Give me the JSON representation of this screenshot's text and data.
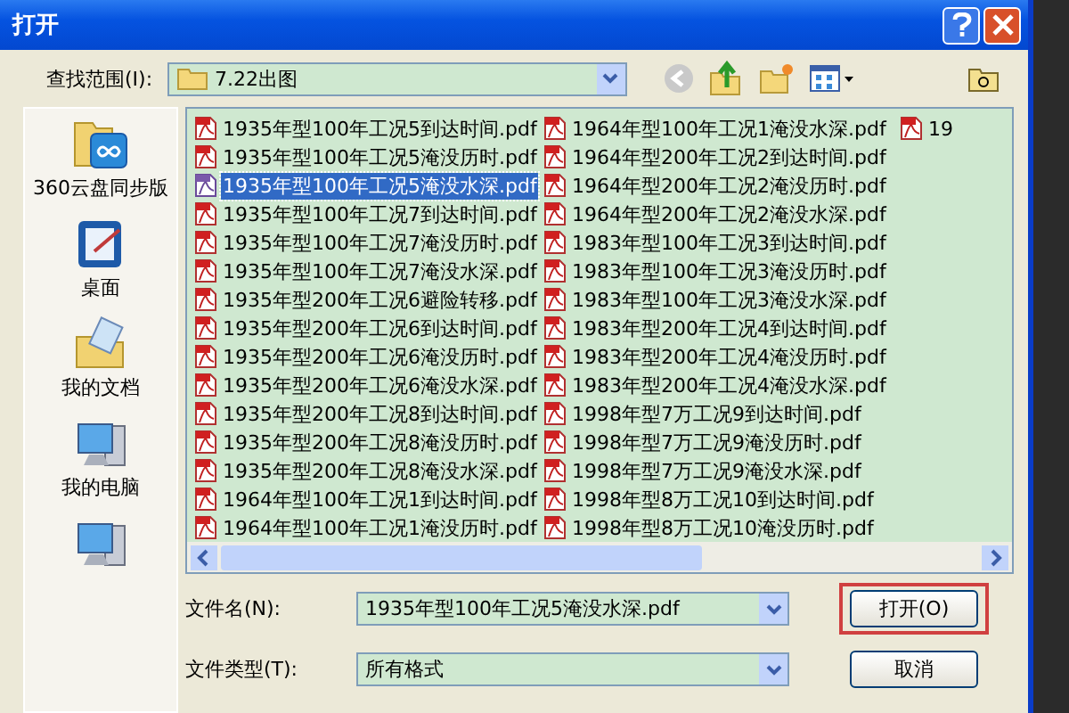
{
  "window": {
    "title": "打开"
  },
  "look_in": {
    "label": "查找范围(I):",
    "value": "7.22出图"
  },
  "sidebar": {
    "items": [
      {
        "label": "360云盘同步版",
        "kind": "cloud"
      },
      {
        "label": "桌面",
        "kind": "desktop"
      },
      {
        "label": "我的文档",
        "kind": "documents"
      },
      {
        "label": "我的电脑",
        "kind": "computer"
      },
      {
        "kind": "network"
      }
    ]
  },
  "files": [
    {
      "name": "1935年型100年工况5到达时间.pdf",
      "selected": false
    },
    {
      "name": "1935年型100年工况5淹没历时.pdf",
      "selected": false
    },
    {
      "name": "1935年型100年工况5淹没水深.pdf",
      "selected": true
    },
    {
      "name": "1935年型100年工况7到达时间.pdf",
      "selected": false
    },
    {
      "name": "1935年型100年工况7淹没历时.pdf",
      "selected": false
    },
    {
      "name": "1935年型100年工况7淹没水深.pdf",
      "selected": false
    },
    {
      "name": "1935年型200年工况6避险转移.pdf",
      "selected": false
    },
    {
      "name": "1935年型200年工况6到达时间.pdf",
      "selected": false
    },
    {
      "name": "1935年型200年工况6淹没历时.pdf",
      "selected": false
    },
    {
      "name": "1935年型200年工况6淹没水深.pdf",
      "selected": false
    },
    {
      "name": "1935年型200年工况8到达时间.pdf",
      "selected": false
    },
    {
      "name": "1935年型200年工况8淹没历时.pdf",
      "selected": false
    },
    {
      "name": "1935年型200年工况8淹没水深.pdf",
      "selected": false
    },
    {
      "name": "1964年型100年工况1到达时间.pdf",
      "selected": false
    },
    {
      "name": "1964年型100年工况1淹没历时.pdf",
      "selected": false
    },
    {
      "name": "1964年型100年工况1淹没水深.pdf",
      "selected": false
    },
    {
      "name": "1964年型200年工况2到达时间.pdf",
      "selected": false
    },
    {
      "name": "1964年型200年工况2淹没历时.pdf",
      "selected": false
    },
    {
      "name": "1964年型200年工况2淹没水深.pdf",
      "selected": false
    },
    {
      "name": "1983年型100年工况3到达时间.pdf",
      "selected": false
    },
    {
      "name": "1983年型100年工况3淹没历时.pdf",
      "selected": false
    },
    {
      "name": "1983年型100年工况3淹没水深.pdf",
      "selected": false
    },
    {
      "name": "1983年型200年工况4到达时间.pdf",
      "selected": false
    },
    {
      "name": "1983年型200年工况4淹没历时.pdf",
      "selected": false
    },
    {
      "name": "1983年型200年工况4淹没水深.pdf",
      "selected": false
    },
    {
      "name": "1998年型7万工况9到达时间.pdf",
      "selected": false
    },
    {
      "name": "1998年型7万工况9淹没历时.pdf",
      "selected": false
    },
    {
      "name": "1998年型7万工况9淹没水深.pdf",
      "selected": false
    },
    {
      "name": "1998年型8万工况10到达时间.pdf",
      "selected": false
    },
    {
      "name": "1998年型8万工况10淹没历时.pdf",
      "selected": false
    },
    {
      "name": "19",
      "selected": false
    }
  ],
  "file_name": {
    "label": "文件名(N):",
    "value": "1935年型100年工况5淹没水深.pdf"
  },
  "file_type": {
    "label": "文件类型(T):",
    "value": "所有格式"
  },
  "buttons": [
    {
      "label": "打开(O)",
      "highlighted": true
    },
    {
      "label": "取消",
      "highlighted": false
    }
  ]
}
